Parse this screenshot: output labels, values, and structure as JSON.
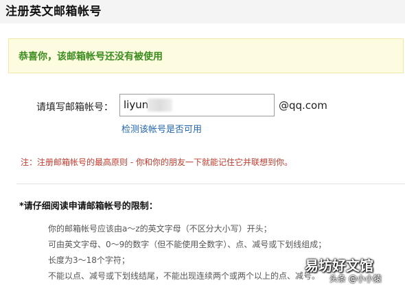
{
  "header": {
    "title": "注册英文邮箱帐号"
  },
  "status": {
    "message": "恭喜你，该邮箱帐号还没有被使用",
    "color": "#3a8c1d"
  },
  "form": {
    "label": "请填写邮箱帐号：",
    "input_value": "liyun",
    "domain_suffix": "@qq.com",
    "check_link": "检测该帐号是否可用"
  },
  "note": {
    "text": "注：注册邮箱帐号的最高原则 - 你和你的朋友一下就能记住它并联想到你。",
    "color": "#c0392b"
  },
  "rules": {
    "title": "*请仔细阅读申请邮箱帐号的限制：",
    "items": [
      "你的邮箱帐号应该由a～z的英文字母（不区分大小写）开头；",
      "可由英文字母、0～9的数字（但不能使用全数字）、点、减号或下划线组成；",
      "长度为3～18个字符；",
      "不能以点、减号或下划线结尾，不能出现连续两个或两个以上的点、减号。"
    ]
  },
  "watermark": {
    "logo": "易坊好文馆",
    "sub": "头条 @小小猿"
  },
  "colors": {
    "link": "#2266b0",
    "header_bg": "#f4f4f4",
    "success_bg": "#fdfce0"
  }
}
